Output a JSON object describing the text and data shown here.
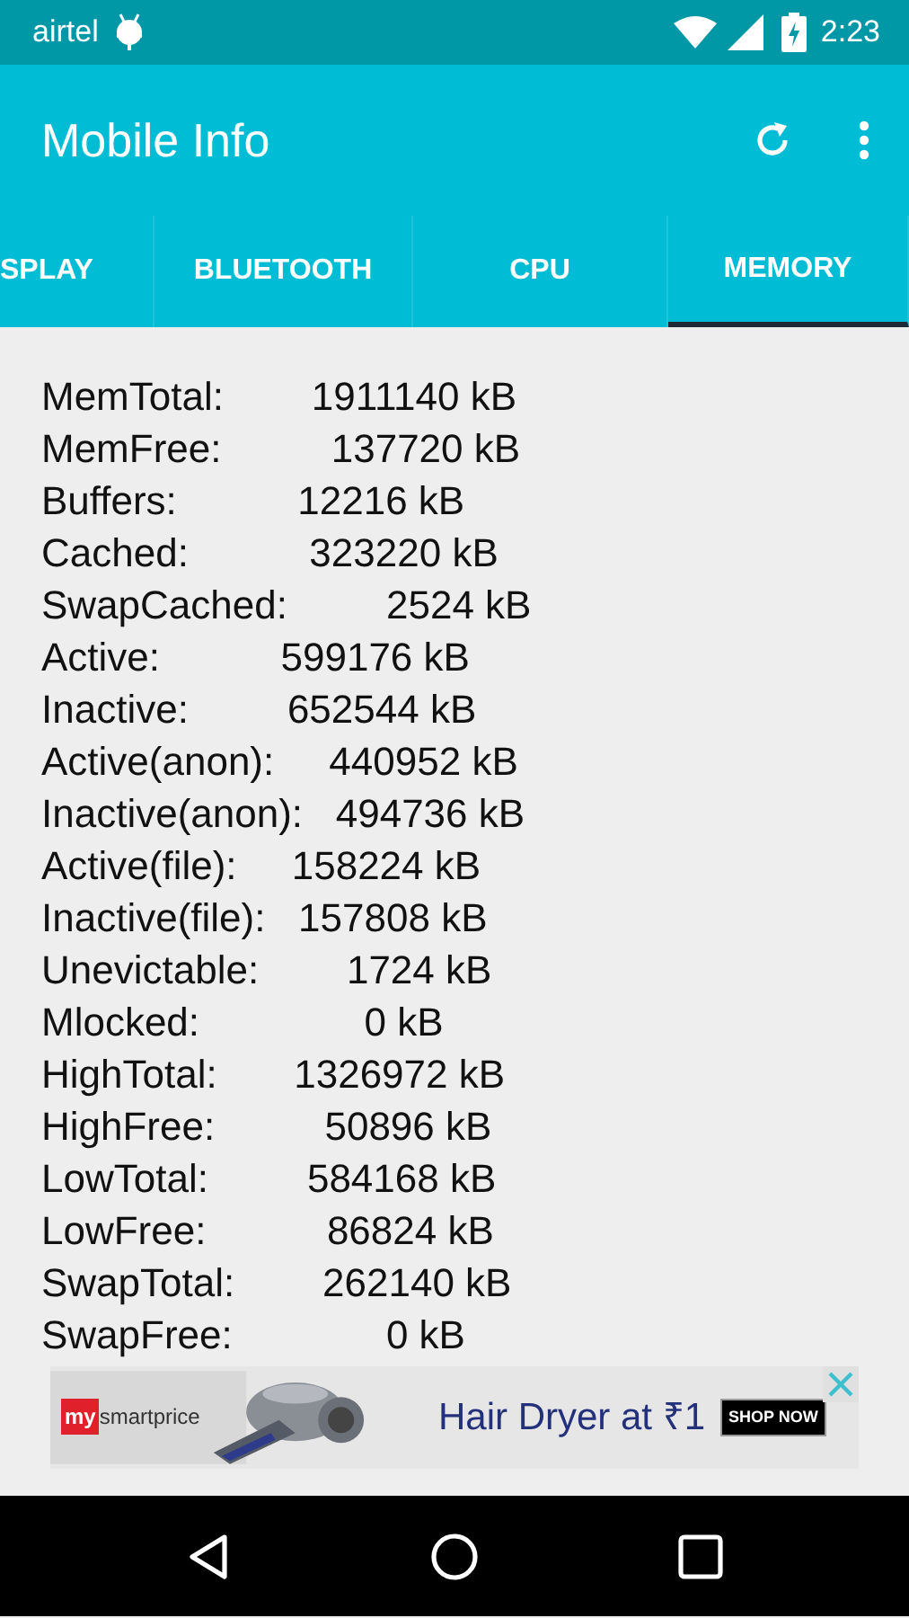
{
  "status_bar": {
    "carrier": "airtel",
    "time": "2:23"
  },
  "app_bar": {
    "title": "Mobile Info"
  },
  "tabs": [
    {
      "label": "SPLAY",
      "selected": false
    },
    {
      "label": "BLUETOOTH",
      "selected": false
    },
    {
      "label": "CPU",
      "selected": false
    },
    {
      "label": "MEMORY",
      "selected": true
    }
  ],
  "memory_lines": [
    "MemTotal:        1911140 kB",
    "MemFree:          137720 kB",
    "Buffers:           12216 kB",
    "Cached:           323220 kB",
    "SwapCached:         2524 kB",
    "Active:           599176 kB",
    "Inactive:         652544 kB",
    "Active(anon):     440952 kB",
    "Inactive(anon):   494736 kB",
    "Active(file):     158224 kB",
    "Inactive(file):   157808 kB",
    "Unevictable:        1724 kB",
    "Mlocked:               0 kB",
    "HighTotal:       1326972 kB",
    "HighFree:          50896 kB",
    "LowTotal:         584168 kB",
    "LowFree:           86824 kB",
    "SwapTotal:        262140 kB",
    "SwapFree:              0 kB"
  ],
  "ad": {
    "brand_badge": "my",
    "brand_name": "smartprice",
    "headline": "Hair Dryer at ₹1",
    "button": "SHOP NOW"
  }
}
